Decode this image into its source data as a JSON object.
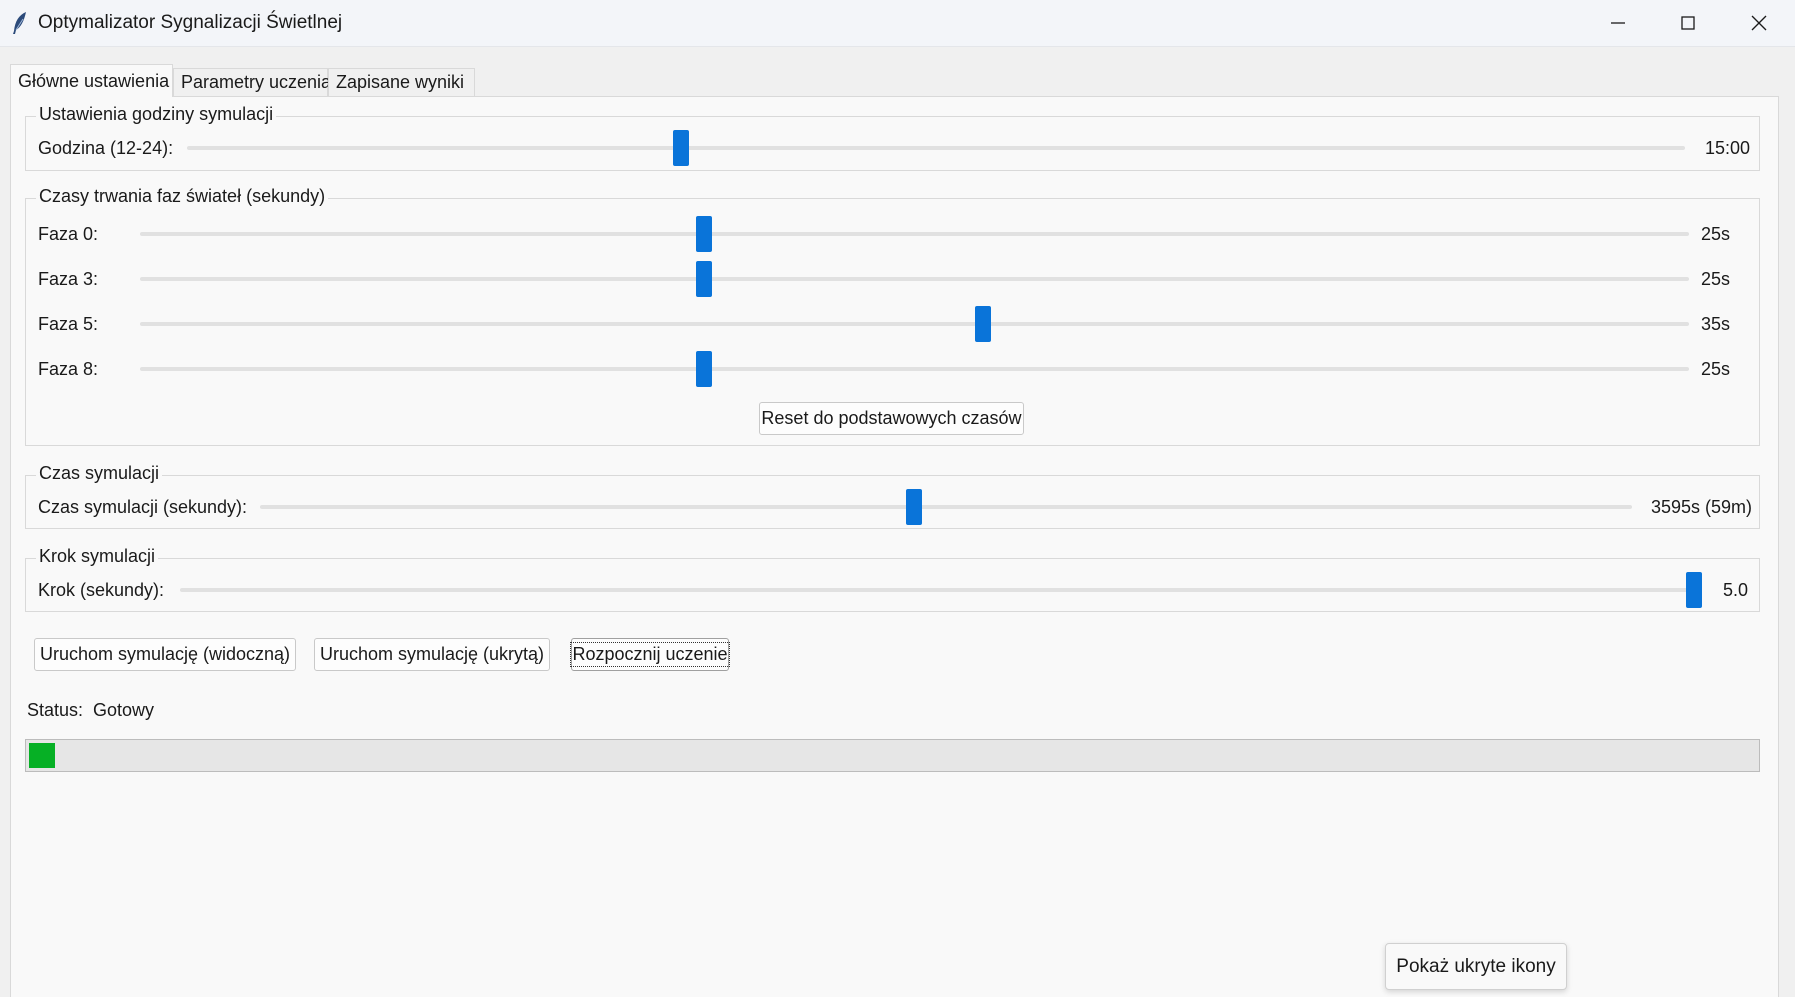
{
  "window": {
    "title": "Optymalizator Sygnalizacji Świetlnej",
    "icon": "feather-icon"
  },
  "tabs": [
    {
      "label": "Główne ustawienia",
      "active": true
    },
    {
      "label": "Parametry uczenia",
      "active": false
    },
    {
      "label": "Zapisane wyniki",
      "active": false
    }
  ],
  "hour_group": {
    "title": "Ustawienia godziny symulacji",
    "label": "Godzina (12-24):",
    "value_text": "15:00",
    "range": [
      12,
      24
    ],
    "value": 15
  },
  "phase_group": {
    "title": "Czasy trwania faz świateł (sekundy)",
    "phases": [
      {
        "label": "Faza 0:",
        "value_text": "25s",
        "value": 25
      },
      {
        "label": "Faza 3:",
        "value_text": "25s",
        "value": 25
      },
      {
        "label": "Faza 5:",
        "value_text": "35s",
        "value": 35
      },
      {
        "label": "Faza 8:",
        "value_text": "25s",
        "value": 25
      }
    ],
    "reset_label": "Reset do podstawowych czasów"
  },
  "sim_time_group": {
    "title": "Czas symulacji",
    "label": "Czas symulacji (sekundy):",
    "value_text": "3595s (59m)",
    "value": 3595
  },
  "step_group": {
    "title": "Krok symulacji",
    "label": "Krok (sekundy):",
    "value_text": "5.0",
    "value": 5.0
  },
  "actions": {
    "run_visible": "Uruchom symulację (widoczną)",
    "run_hidden": "Uruchom symulację (ukrytą)",
    "start_learning": "Rozpocznij uczenie"
  },
  "status": {
    "label": "Status:",
    "value": "Gotowy"
  },
  "progress": {
    "fraction": 0.015,
    "color": "#06b025"
  },
  "tooltip": {
    "text": "Pokaż ukryte ikony"
  },
  "colors": {
    "slider_thumb": "#0a74d9",
    "progress_fill": "#06b025"
  }
}
